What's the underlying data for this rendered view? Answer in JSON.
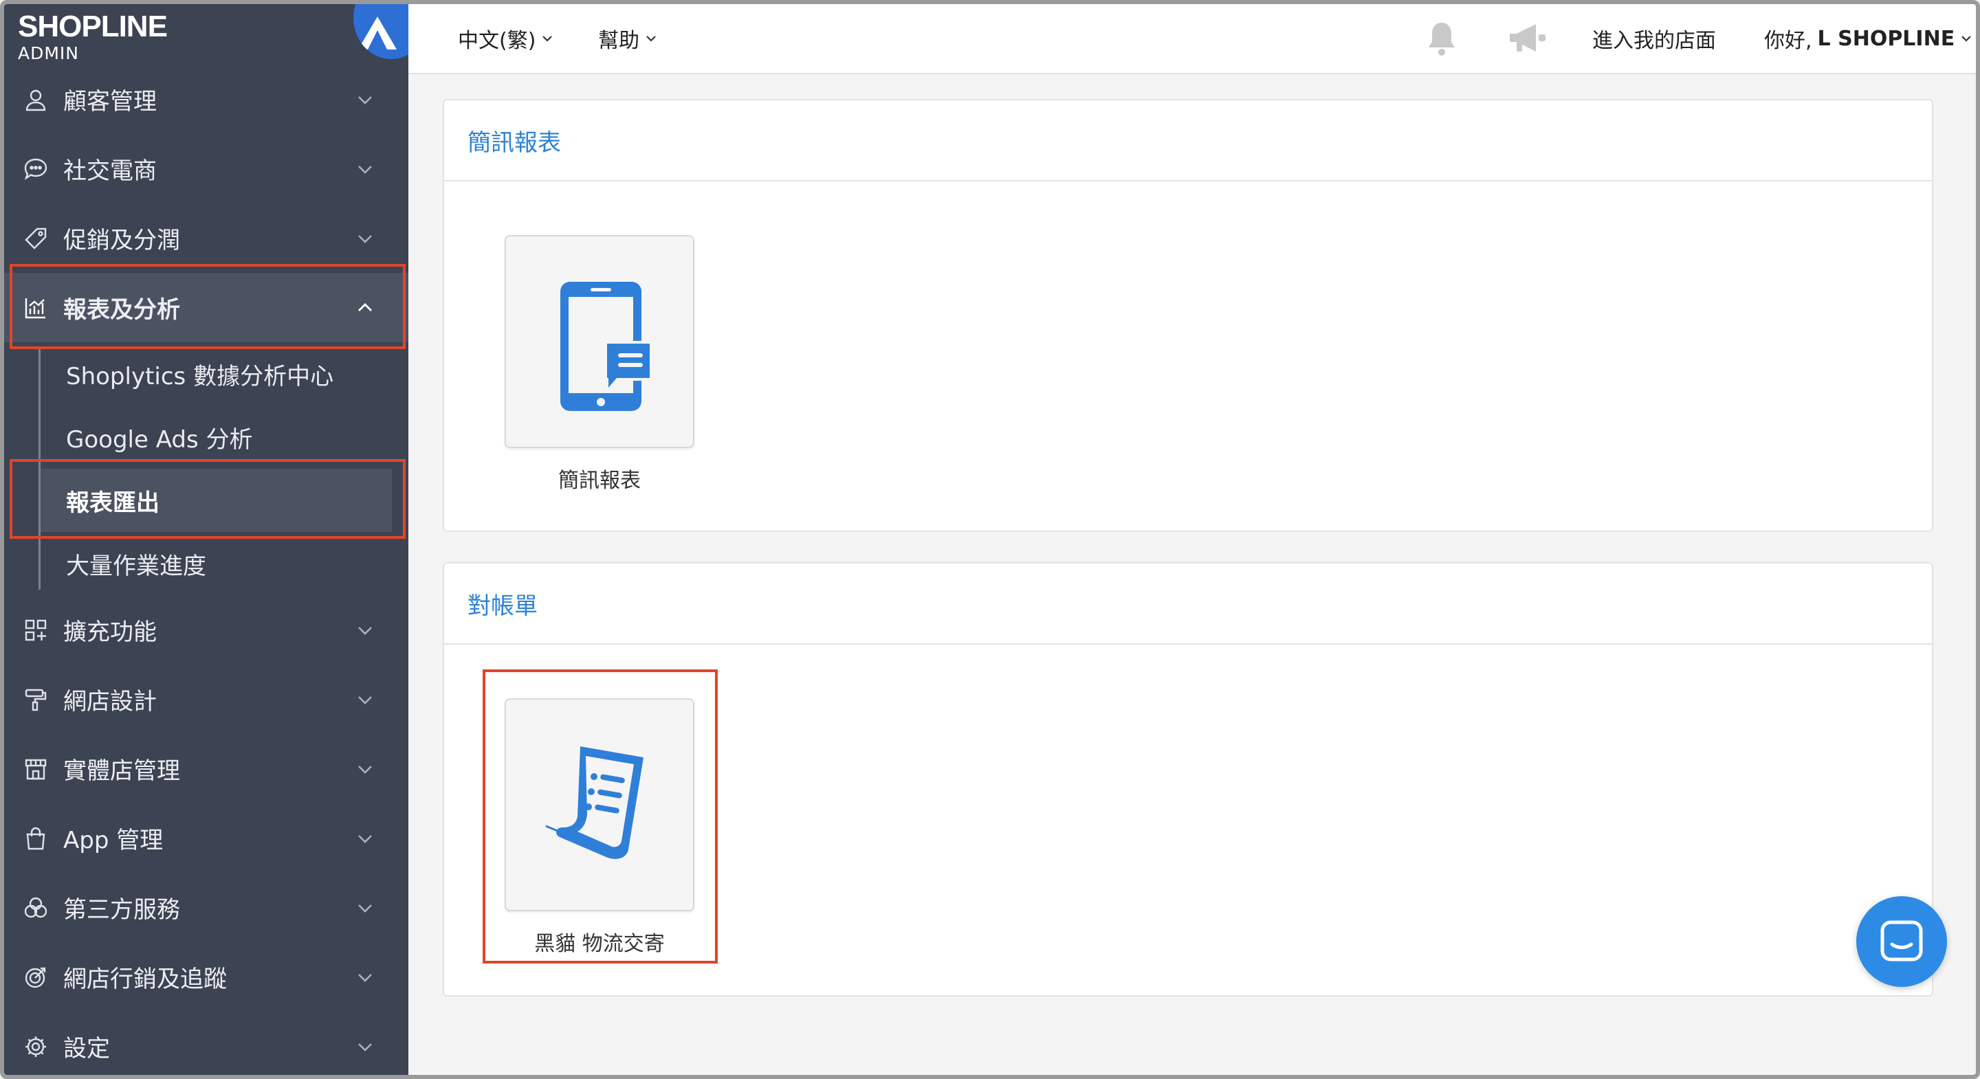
{
  "brand": {
    "name": "SHOPLINE",
    "sub": "ADMIN"
  },
  "sidebar": {
    "items_top": [
      {
        "label": "顧客管理",
        "icon": "user-icon"
      },
      {
        "label": "社交電商",
        "icon": "chat-bubble-icon"
      },
      {
        "label": "促銷及分潤",
        "icon": "tag-icon"
      }
    ],
    "open_item": {
      "label": "報表及分析",
      "icon": "chart-icon"
    },
    "submenu": [
      {
        "label": "Shoplytics 數據分析中心"
      },
      {
        "label": "Google Ads 分析"
      },
      {
        "label": "報表匯出",
        "active": true
      },
      {
        "label": "大量作業進度"
      }
    ],
    "items_bottom": [
      {
        "label": "擴充功能",
        "icon": "apps-icon"
      },
      {
        "label": "網店設計",
        "icon": "paint-roller-icon"
      },
      {
        "label": "實體店管理",
        "icon": "store-icon"
      },
      {
        "label": "App 管理",
        "icon": "shopping-bag-icon"
      },
      {
        "label": "第三方服務",
        "icon": "circles-icon"
      },
      {
        "label": "網店行銷及追蹤",
        "icon": "target-icon"
      },
      {
        "label": "設定",
        "icon": "gear-icon"
      }
    ]
  },
  "topbar": {
    "language": "中文(繁)",
    "help": "幫助",
    "storefront": "進入我的店面",
    "greeting_prefix": "你好,",
    "greeting_name": "L SHOPLINE"
  },
  "panels": [
    {
      "title": "簡訊報表",
      "tiles": [
        {
          "label": "簡訊報表",
          "icon": "phone-message-icon"
        }
      ]
    },
    {
      "title": "對帳單",
      "tiles": [
        {
          "label": "黑貓 物流交寄",
          "icon": "receipt-scroll-icon"
        }
      ]
    }
  ],
  "colors": {
    "sidebar": "#3c4352",
    "accent": "#2c83d6",
    "highlight": "#e0452b",
    "chat": "#2d8be6"
  }
}
